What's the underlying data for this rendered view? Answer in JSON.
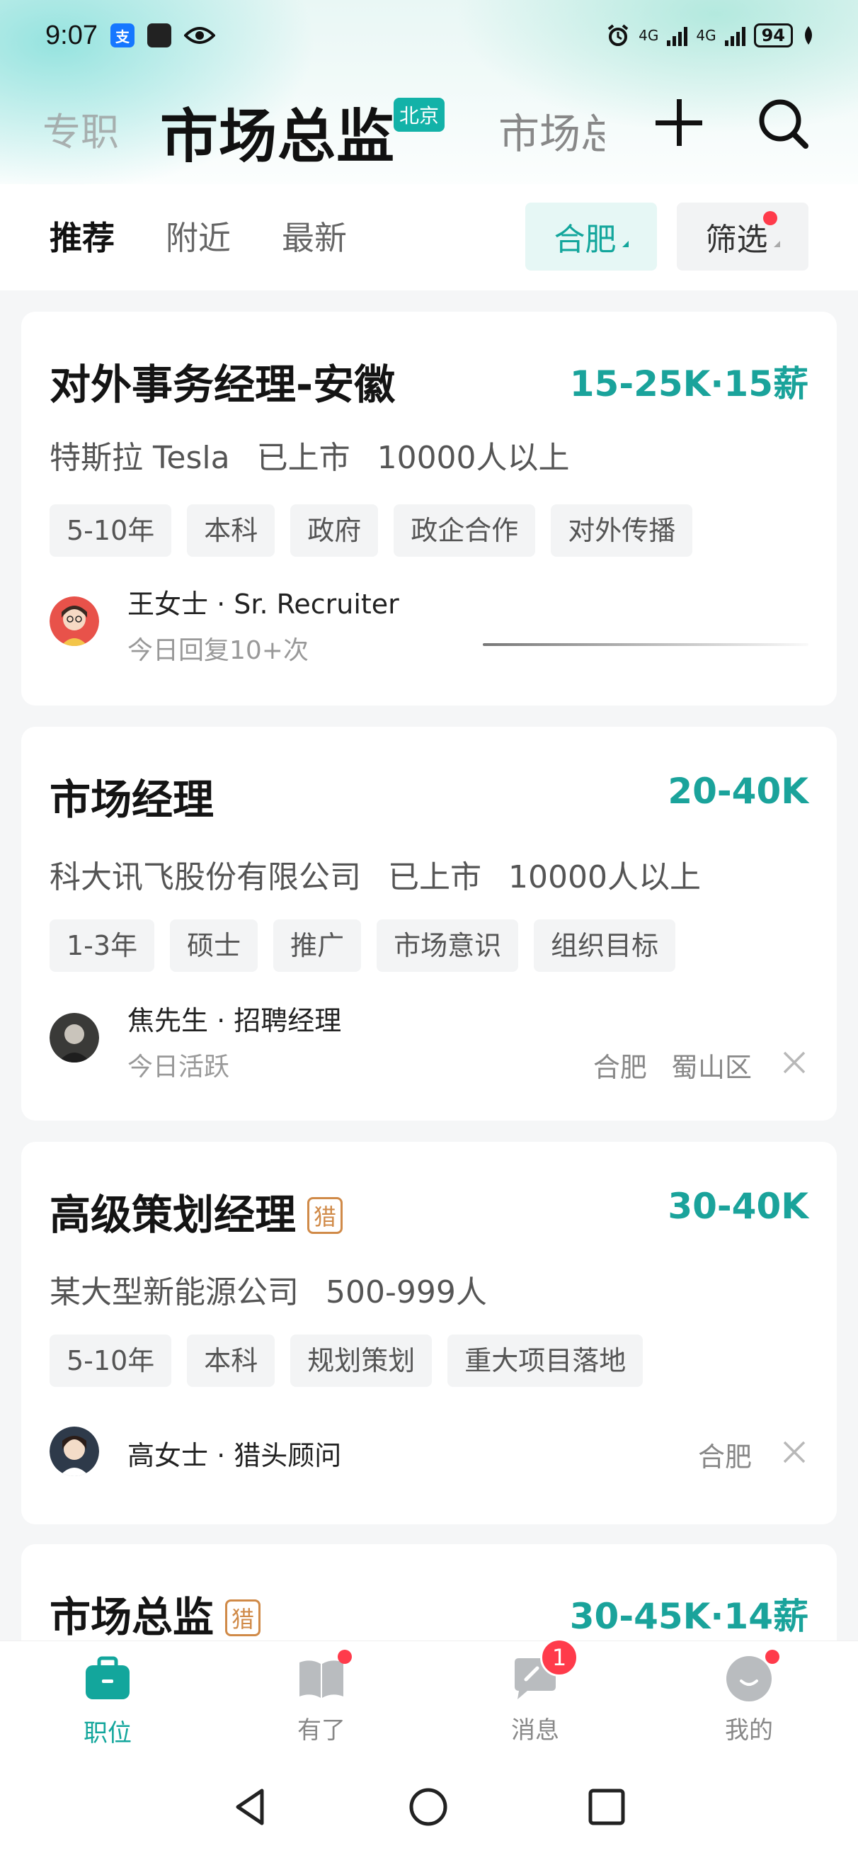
{
  "status_bar": {
    "time": "9:07",
    "alipay_glyph": "支",
    "network_1": "4G",
    "network_2": "4G",
    "battery": "94"
  },
  "header": {
    "prev_tab": "专职",
    "current_tab": "市场总监",
    "city_badge": "北京",
    "next_tab": "市场总监"
  },
  "filters": {
    "tabs": [
      "推荐",
      "附近",
      "最新"
    ],
    "city": "合肥",
    "filter_label": "筛选"
  },
  "jobs": [
    {
      "title": "对外事务经理-安徽",
      "salary": "15-25K·15薪",
      "company": "特斯拉 Tesla",
      "stage": "已上市",
      "size": "10000人以上",
      "tags": [
        "5-10年",
        "本科",
        "政府",
        "政企合作",
        "对外传播"
      ],
      "recruiter": "王女士 · Sr. Recruiter",
      "activity": "今日回复10+次"
    },
    {
      "title": "市场经理",
      "salary": "20-40K",
      "company": "科大讯飞股份有限公司",
      "stage": "已上市",
      "size": "10000人以上",
      "tags": [
        "1-3年",
        "硕士",
        "推广",
        "市场意识",
        "组织目标"
      ],
      "recruiter": "焦先生 · 招聘经理",
      "activity": "今日活跃",
      "city": "合肥",
      "district": "蜀山区"
    },
    {
      "title": "高级策划经理",
      "hunter": "猎",
      "salary": "30-40K",
      "company": "某大型新能源公司",
      "size": "500-999人",
      "tags": [
        "5-10年",
        "本科",
        "规划策划",
        "重大项目落地"
      ],
      "recruiter": "高女士 · 猎头顾问",
      "city": "合肥"
    },
    {
      "title": "市场总监",
      "hunter": "猎",
      "salary": "30-45K·14薪"
    }
  ],
  "bottom_nav": {
    "items": [
      "职位",
      "有了",
      "消息",
      "我的"
    ],
    "message_badge": "1"
  },
  "colors": {
    "accent": "#13a69c",
    "badge_red": "#ff3b4b",
    "hunter": "#d08a48"
  }
}
